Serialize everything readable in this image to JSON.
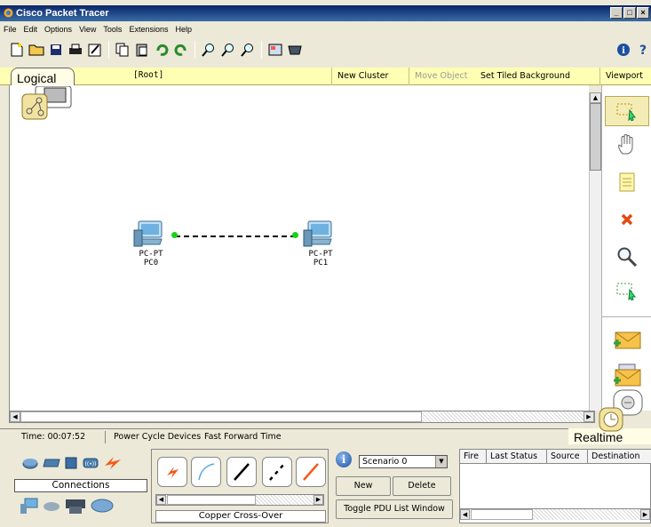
{
  "window": {
    "title": "Cisco Packet Tracer",
    "minimize": "_",
    "maximize": "□",
    "close": "×"
  },
  "menu": [
    "File",
    "Edit",
    "Options",
    "View",
    "Tools",
    "Extensions",
    "Help"
  ],
  "workspace": {
    "mode_tab": "Logical",
    "path": "[Root]",
    "new_cluster": "New Cluster",
    "move_object": "Move Object",
    "set_tiled_background": "Set Tiled Background",
    "viewport": "Viewport"
  },
  "devices": [
    {
      "type": "PC-PT",
      "name": "PC0"
    },
    {
      "type": "PC-PT",
      "name": "PC1"
    }
  ],
  "status": {
    "time": "Time: 00:07:52",
    "power_cycle": "Power Cycle Devices",
    "fast_forward": "Fast Forward Time",
    "mode": "Realtime"
  },
  "device_panel": {
    "category_label": "Connections"
  },
  "cable_panel": {
    "selected_label": "Copper Cross-Over"
  },
  "scenario": {
    "selected": "Scenario 0",
    "new_button": "New",
    "delete_button": "Delete",
    "toggle_button": "Toggle PDU List Window"
  },
  "pdu_table": {
    "columns": [
      "Fire",
      "Last Status",
      "Source",
      "Destination"
    ]
  },
  "colors": {
    "link_port": "#19d219",
    "workspace_bar": "#ffffb4",
    "accent_title": "#0a246a"
  }
}
